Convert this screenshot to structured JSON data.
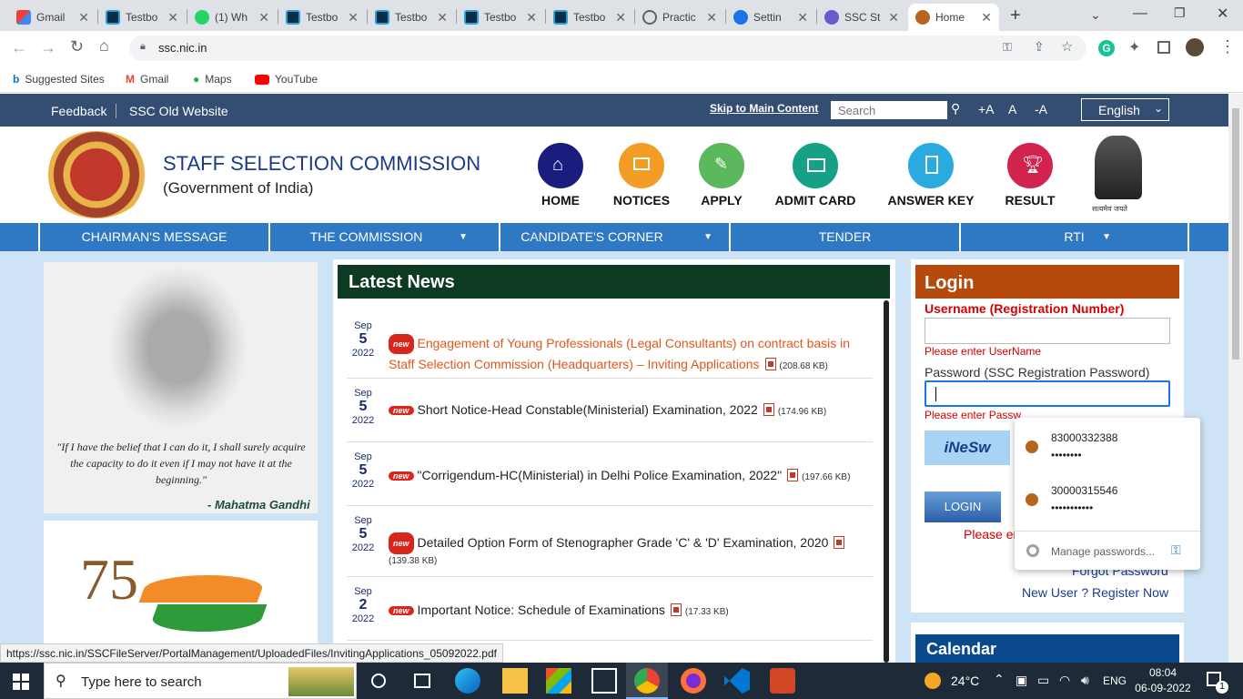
{
  "browser": {
    "tabs": [
      {
        "title": "Gmail",
        "icon": "gmail-icon"
      },
      {
        "title": "Testbo",
        "icon": "testbook-icon"
      },
      {
        "title": "(1) Wh",
        "icon": "whatsapp-icon"
      },
      {
        "title": "Testbo",
        "icon": "testbook-icon"
      },
      {
        "title": "Testbo",
        "icon": "testbook-icon"
      },
      {
        "title": "Testbo",
        "icon": "testbook-icon"
      },
      {
        "title": "Testbo",
        "icon": "testbook-icon"
      },
      {
        "title": "Practic",
        "icon": "globe-icon"
      },
      {
        "title": "Settin",
        "icon": "settings-icon"
      },
      {
        "title": "SSC St",
        "icon": "ssc-icon"
      },
      {
        "title": "Home",
        "icon": "ssc-emblem-icon"
      }
    ],
    "new_tab": "+",
    "url": "ssc.nic.in",
    "bookmarks": [
      "Suggested Sites",
      "Gmail",
      "Maps",
      "YouTube"
    ],
    "status_url": "https://ssc.nic.in/SSCFileServer/PortalManagement/UploadedFiles/InvitingApplications_05092022.pdf"
  },
  "site": {
    "topbar": {
      "feedback": "Feedback",
      "old_site": "SSC Old Website",
      "skip": "Skip to Main Content",
      "search_placeholder": "Search",
      "font_plus": "+A",
      "font_normal": "A",
      "font_minus": "-A",
      "language": "English"
    },
    "org_name": "STAFF SELECTION COMMISSION",
    "org_sub": "(Government of India)",
    "emblem_text": "सत्यमेव जयते",
    "quick_links": [
      {
        "label": "HOME",
        "color": "#1b1d7e"
      },
      {
        "label": "NOTICES",
        "color": "#f39c26"
      },
      {
        "label": "APPLY",
        "color": "#5cb85c"
      },
      {
        "label": "ADMIT CARD",
        "color": "#16a085"
      },
      {
        "label": "ANSWER KEY",
        "color": "#29abe2"
      },
      {
        "label": "RESULT",
        "color": "#d2234f"
      }
    ],
    "nav": [
      {
        "label": "CHAIRMAN'S MESSAGE",
        "dropdown": false
      },
      {
        "label": "THE COMMISSION",
        "dropdown": true
      },
      {
        "label": "CANDIDATE'S CORNER",
        "dropdown": true
      },
      {
        "label": "TENDER",
        "dropdown": false
      },
      {
        "label": "RTI",
        "dropdown": true
      }
    ],
    "quote": "\"If I have the belief that I can do it, I shall surely acquire the capacity to do it even if I may not have it at the beginning.\"",
    "quote_author": "- Mahatma Gandhi",
    "news_title": "Latest News",
    "news": [
      {
        "month": "Sep",
        "day": "5",
        "year": "2022",
        "text": "Engagement of Young Professionals (Legal Consultants) on contract basis in Staff Selection Commission (Headquarters) – Inviting Applications",
        "size": "(208.68 KB)",
        "highlight": true
      },
      {
        "month": "Sep",
        "day": "5",
        "year": "2022",
        "text": "Short Notice-Head Constable(Ministerial) Examination, 2022",
        "size": "(174.96 KB)",
        "highlight": false
      },
      {
        "month": "Sep",
        "day": "5",
        "year": "2022",
        "text": "\"Corrigendum-HC(Ministerial) in Delhi Police Examination, 2022\"",
        "size": "(197.66 KB)",
        "highlight": false
      },
      {
        "month": "Sep",
        "day": "5",
        "year": "2022",
        "text": "Detailed Option Form of Stenographer Grade 'C' & 'D' Examination, 2020",
        "size": "(139.38 KB)",
        "highlight": false
      },
      {
        "month": "Sep",
        "day": "2",
        "year": "2022",
        "text": "Important Notice: Schedule of Examinations",
        "size": "(17.33 KB)",
        "highlight": false
      }
    ],
    "new_badge": "new",
    "login": {
      "title": "Login",
      "username_label": "Username (Registration Number)",
      "username_error": "Please enter UserName",
      "password_label": "Password (SSC Registration Password)",
      "password_error": "Please enter Passw",
      "captcha": "iNeSw",
      "button": "LOGIN",
      "error_partial": "Please en",
      "forgot": "Forgot Password",
      "new_user": "New User ? Register Now"
    },
    "autofill": {
      "entries": [
        {
          "user": "83000332388",
          "pass": "••••••••"
        },
        {
          "user": "30000315546",
          "pass": "•••••••••••"
        }
      ],
      "manage": "Manage passwords..."
    },
    "calendar_title": "Calendar"
  },
  "taskbar": {
    "search_placeholder": "Type here to search",
    "temp": "24°C",
    "lang": "ENG",
    "time": "08:04",
    "date": "06-09-2022",
    "notif_count": "1"
  }
}
